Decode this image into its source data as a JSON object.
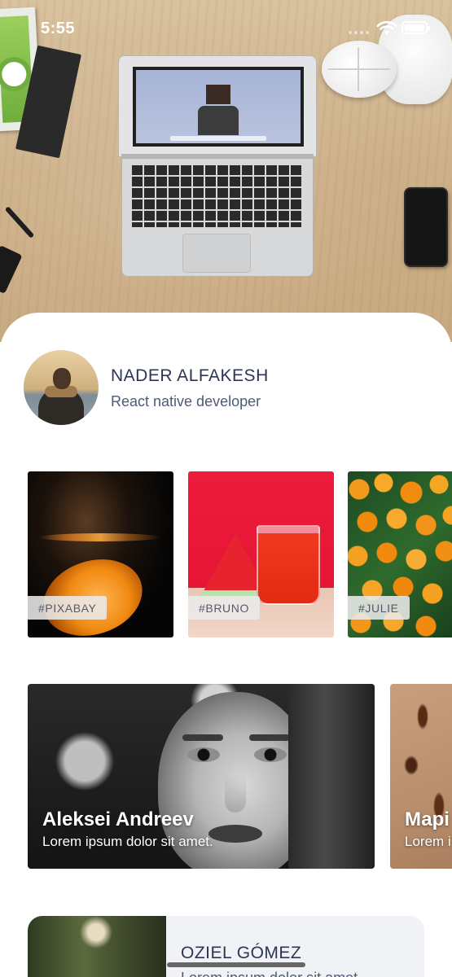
{
  "status_bar": {
    "time": "5:55",
    "signal_dots": 4,
    "wifi_icon": "wifi-icon",
    "battery_icon": "battery-icon"
  },
  "hero": {
    "image": "desk-with-laptop-photo"
  },
  "profile": {
    "name": "NADER ALFAKESH",
    "role": "React native developer",
    "avatar": "person-avatar"
  },
  "tag_tiles": [
    {
      "label": "#PIXABAY"
    },
    {
      "label": "#BRUNO"
    },
    {
      "label": "#JULIE"
    }
  ],
  "feature_cards": [
    {
      "title": "Aleksei Andreev",
      "subtitle": "Lorem ipsum dolor sit amet."
    },
    {
      "title": "Марі",
      "subtitle": "Lorem i"
    }
  ],
  "list_cards": [
    {
      "title": "OZIEL GÓMEZ",
      "subtitle": "Lorem ipsum dolor sit amet."
    }
  ],
  "colors": {
    "heading_text": "#2c3552",
    "secondary_text": "#4e5a78",
    "sheet_background": "#ffffff",
    "list_card_background": "#f1f2f6"
  }
}
